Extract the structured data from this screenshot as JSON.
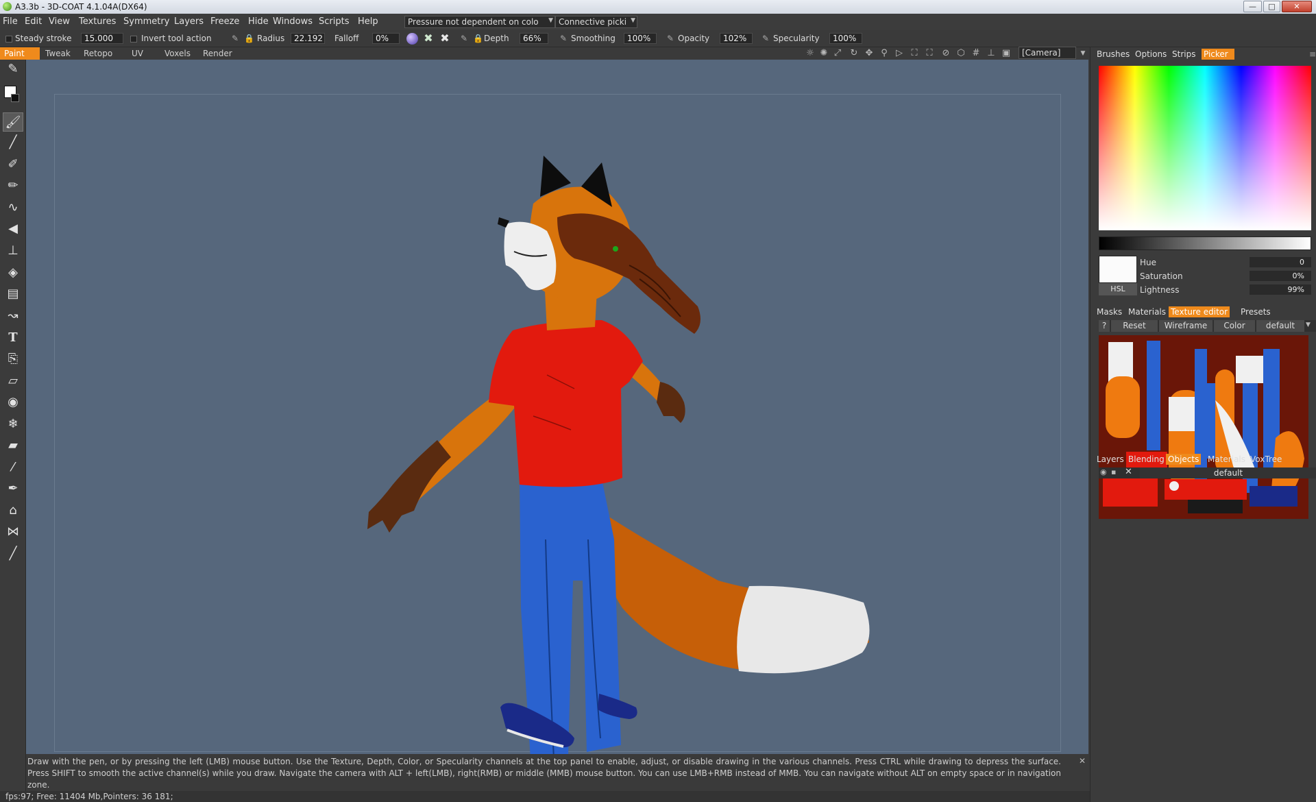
{
  "window": {
    "title": "A3.3b - 3D-COAT 4.1.04A(DX64)",
    "buttons": [
      "—",
      "□",
      "✕"
    ]
  },
  "menu": {
    "items": [
      "File",
      "Edit",
      "View",
      "Textures",
      "Symmetry",
      "Layers",
      "Freeze",
      "Hide",
      "Windows",
      "Scripts",
      "Help"
    ],
    "pressure_dropdown": "Pressure not dependent on colo",
    "connective_dropdown": "Connective picki"
  },
  "tool_options": {
    "steady_stroke_label": "Steady stroke",
    "steady_stroke_value": "15.000",
    "invert_label": "Invert tool action",
    "radius_label": "Radius",
    "radius_value": "22.192",
    "falloff_label": "Falloff",
    "falloff_value": "0%",
    "depth_label": "Depth",
    "depth_value": "66%",
    "smoothing_label": "Smoothing",
    "smoothing_value": "100%",
    "opacity_label": "Opacity",
    "opacity_value": "102%",
    "specularity_label": "Specularity",
    "specularity_value": "100%"
  },
  "rooms": {
    "tabs": [
      "Paint",
      "Tweak",
      "Retopo",
      "UV",
      "Voxels",
      "Render"
    ],
    "active": "Paint"
  },
  "viewport": {
    "camera_dropdown": "[Camera]"
  },
  "right_panel": {
    "top_tabs": [
      "Brushes",
      "Options",
      "Strips",
      "Picker"
    ],
    "active_top_tab": "Picker",
    "hsl_button": "HSL",
    "hue_label": "Hue",
    "hue_value": "0",
    "saturation_label": "Saturation",
    "saturation_value": "0%",
    "lightness_label": "Lightness",
    "lightness_value": "99%",
    "mid_tabs": [
      "Masks",
      "Materials",
      "Texture editor",
      "Presets"
    ],
    "active_mid_tab": "Texture editor",
    "tex_buttons": {
      "help": "?",
      "reset": "Reset",
      "wireframe": "Wireframe",
      "color": "Color",
      "preset": "default"
    },
    "bottom_tabs": [
      "Layers",
      "Blending",
      "Objects",
      "Materials",
      "VoxTree"
    ],
    "active_bottom_tab": "Objects",
    "object_name": "default"
  },
  "hint": "Draw with the pen, or by pressing the left (LMB) mouse button. Use the Texture, Depth, Color, or Specularity channels at the top panel to enable, adjust, or disable drawing in the various channels. Press CTRL while drawing to depress the surface. Press SHIFT to smooth the active channel(s) while you draw. Navigate the camera with ALT + left(LMB), right(RMB)  or middle (MMB) mouse button. You can use LMB+RMB instead of MMB. You can navigate without ALT on empty space or in navigation zone.",
  "status": "fps:97;     Free: 11404 Mb,Pointers: 36 181;",
  "colors": {
    "accent": "#ef8a1c",
    "viewport_bg": "#56677c",
    "panel_bg": "#3b3b3b"
  }
}
